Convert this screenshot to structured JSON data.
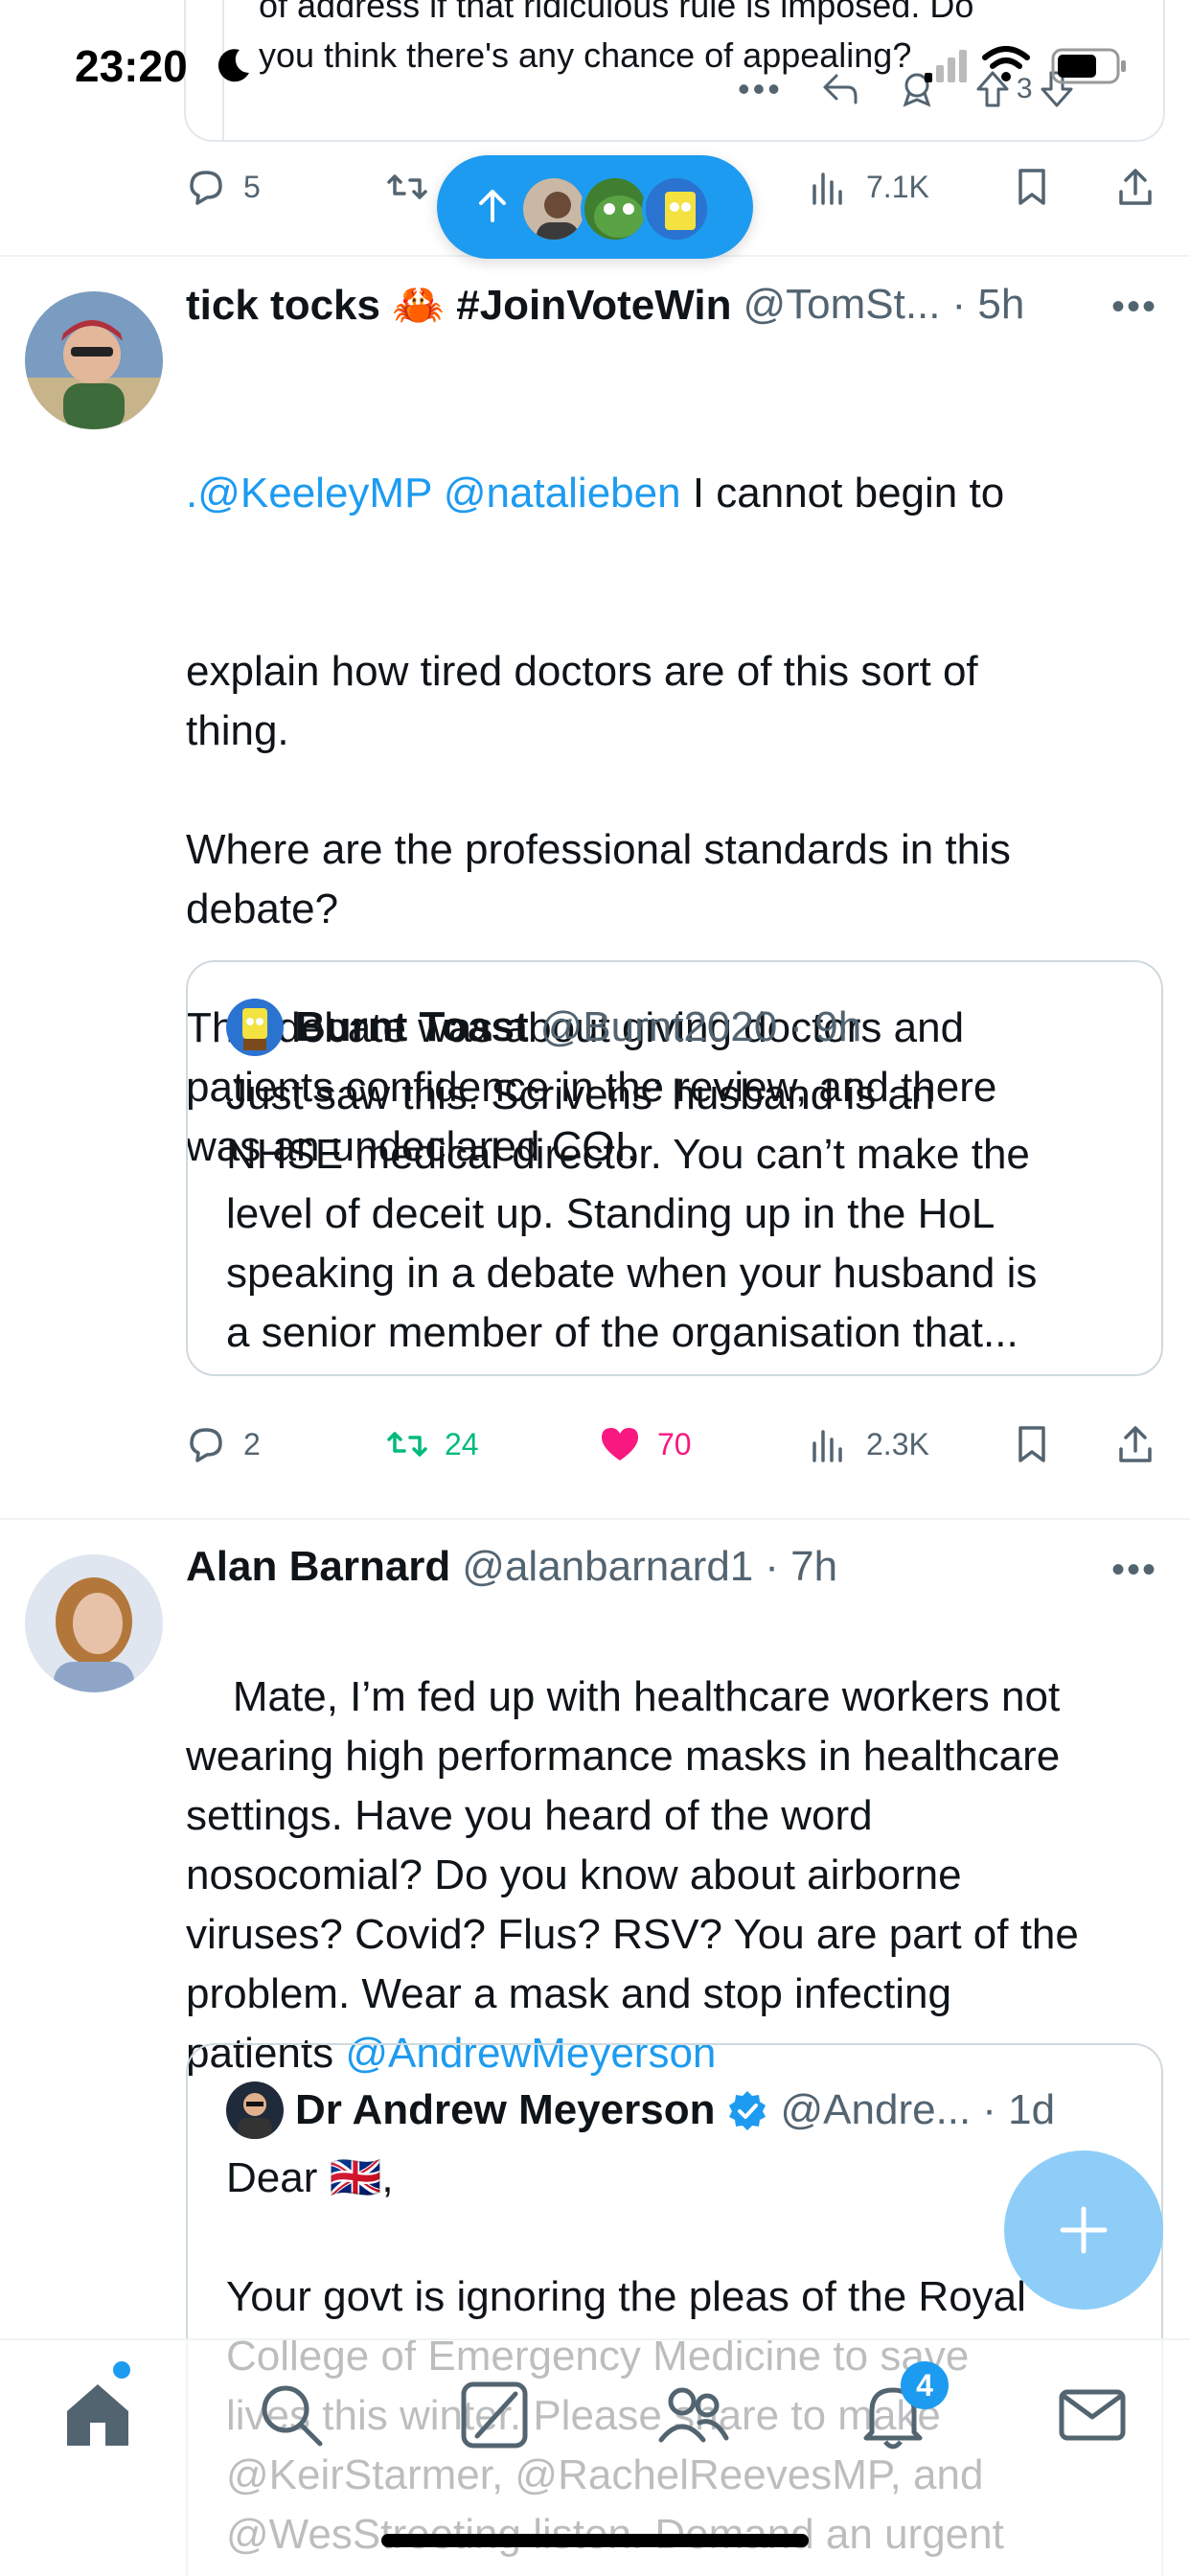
{
  "status_bar": {
    "time": "23:20"
  },
  "prev_tweet": {
    "quote_text_line1": "of address if that ridiculous rule is imposed. Do",
    "quote_text_line2": "you think there's any chance of appealing?",
    "quote_down_count": "3",
    "actions": {
      "replies": "5",
      "views": "7.1K"
    }
  },
  "tweets": [
    {
      "name": "tick tocks 🦀 #JoinVoteWin",
      "handle": "@TomSt...",
      "time": "· 5h",
      "body_mentions": ".@KeeleyMP @natalieben",
      "body_rest_line": " I cannot begin to",
      "body_text": "explain how tired doctors are of this sort of\nthing.\n\nWhere are the professional standards in this\ndebate?\n\nThis debate was about giving doctors and\npatients confidence in the review, and there\nwas an undeclared COI.",
      "quote": {
        "name": "Burnt Toast",
        "handle": "@Burnt2020",
        "time": "· 9h",
        "text": "Just saw this. Scrivens’ husband is an\nNHSE medical director. You can’t make the\nlevel of deceit up. Standing up in the HoL\nspeaking in a debate when your husband is\na senior member of the organisation that..."
      },
      "actions": {
        "replies": "2",
        "reposts": "24",
        "likes": "70",
        "views": "2.3K"
      }
    },
    {
      "name": "Alan Barnard",
      "handle": "@alanbarnard1",
      "time": "· 7h",
      "body_text": "Mate, I’m fed up with healthcare workers not\nwearing high performance masks in healthcare\nsettings. Have you heard of the word\nnosocomial? Do you know about airborne\nviruses? Covid? Flus? RSV? You are part of the\nproblem. Wear a mask and stop infecting\npatients ",
      "body_mention_end": "@AndrewMeyerson",
      "quote": {
        "name": "Dr Andrew Meyerson",
        "handle": "@Andre...",
        "time": "· 1d",
        "text": "Dear 🇬🇧,\n\nYour govt is ignoring the pleas of the Royal\nCollege of Emergency Medicine to save\nlives this winter. Please share to make\n@KeirStarmer, @RachelReevesMP, and\n@WesStreeting listen. Demand an urgent"
      }
    }
  ],
  "bottom_nav": {
    "notifications_badge": "4"
  },
  "colors": {
    "accent": "#1d9bf0",
    "repost_green": "#00ba7c",
    "like_pink": "#f91880",
    "muted": "#536471"
  }
}
